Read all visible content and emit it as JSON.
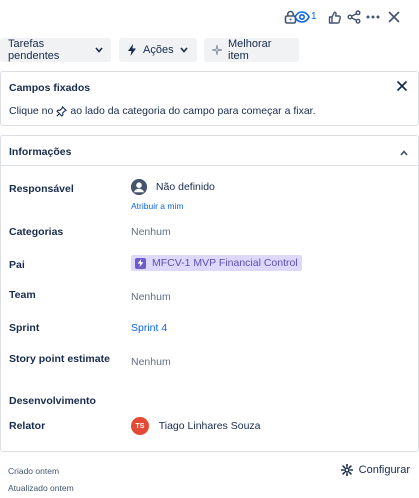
{
  "topbar": {
    "watch_count": "1"
  },
  "actions": {
    "status_label": "Tarefas pendentes",
    "actions_label": "Ações",
    "improve_label": "Melhorar item"
  },
  "pinned": {
    "title": "Campos fixados",
    "hint_before": "Clique no",
    "hint_after": "ao lado da categoria do campo para começar a fixar."
  },
  "info": {
    "title": "Informações",
    "fields": {
      "assignee_label": "Responsável",
      "assignee_value": "Não definido",
      "assign_to_me": "Atribuir a mim",
      "categories_label": "Categorias",
      "categories_value": "Nenhum",
      "parent_label": "Pai",
      "parent_value": "MFCV-1 MVP Financial Control",
      "team_label": "Team",
      "team_value": "Nenhum",
      "sprint_label": "Sprint",
      "sprint_value": "Sprint 4",
      "story_points_label": "Story point estimate",
      "story_points_value": "Nenhum",
      "development_label": "Desenvolvimento",
      "reporter_label": "Relator",
      "reporter_initials": "TS",
      "reporter_value": "Tiago Linhares Souza"
    }
  },
  "footer": {
    "created": "Criado ontem",
    "updated": "Atualizado ontem",
    "configure": "Configurar"
  },
  "colors": {
    "link": "#0c66e4",
    "parent_bg": "#dfd8fd",
    "reporter_avatar": "#e34935"
  }
}
